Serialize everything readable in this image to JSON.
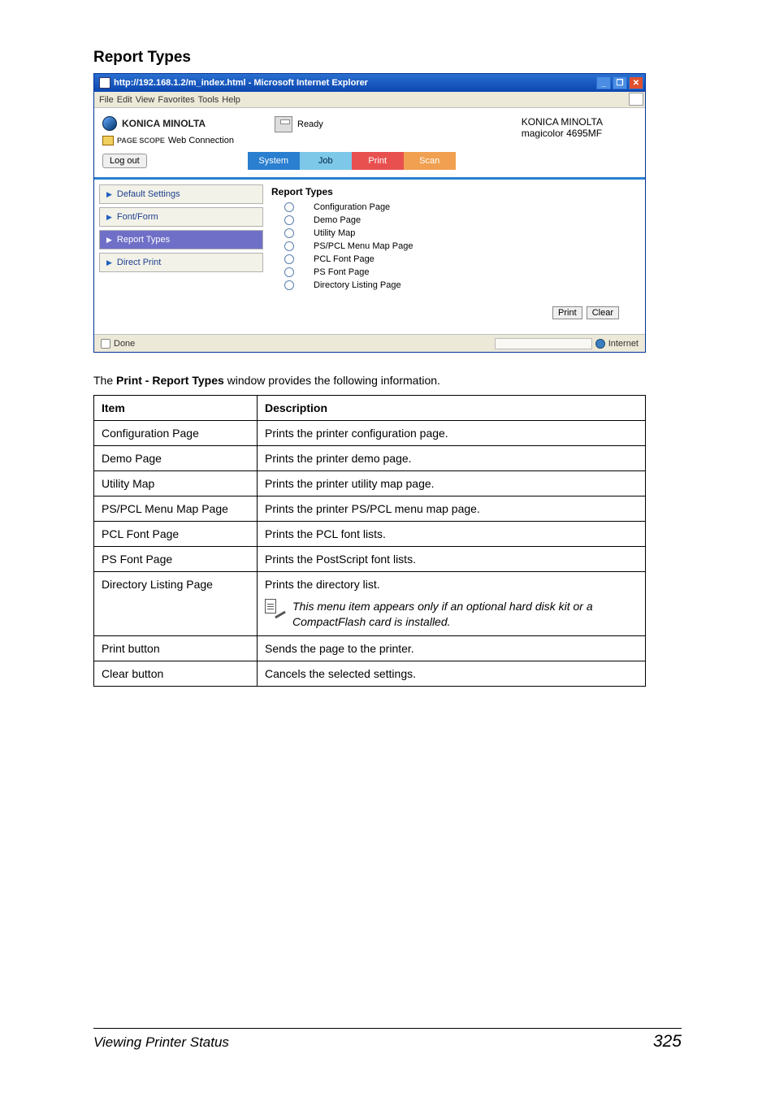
{
  "section_heading": "Report Types",
  "browser": {
    "title": "http://192.168.1.2/m_index.html - Microsoft Internet Explorer",
    "menu": [
      "File",
      "Edit",
      "View",
      "Favorites",
      "Tools",
      "Help"
    ],
    "brand": "KONICA MINOLTA",
    "pagescope_prefix": "PAGE SCOPE",
    "pagescope": "Web Connection",
    "status_text": "Ready",
    "model_brand": "KONICA MINOLTA",
    "model_name": "magicolor 4695MF",
    "logout": "Log out",
    "tabs": {
      "system": "System",
      "job": "Job",
      "print": "Print",
      "scan": "Scan"
    },
    "sidebar": {
      "items": [
        {
          "label": "Default Settings"
        },
        {
          "label": "Font/Form"
        },
        {
          "label": "Report Types"
        },
        {
          "label": "Direct Print"
        }
      ]
    },
    "panel_title": "Report Types",
    "options": [
      "Configuration Page",
      "Demo Page",
      "Utility Map",
      "PS/PCL Menu Map Page",
      "PCL Font Page",
      "PS Font Page",
      "Directory Listing Page"
    ],
    "print_btn": "Print",
    "clear_btn": "Clear",
    "status_done": "Done",
    "status_zone": "Internet"
  },
  "intro_pre": "The ",
  "intro_bold": "Print - Report Types",
  "intro_post": " window provides the following information.",
  "table": {
    "head_item": "Item",
    "head_desc": "Description",
    "rows": [
      {
        "item": "Configuration Page",
        "desc": "Prints the printer configuration page."
      },
      {
        "item": "Demo Page",
        "desc": "Prints the printer demo page."
      },
      {
        "item": "Utility Map",
        "desc": "Prints the printer utility map page."
      },
      {
        "item": "PS/PCL Menu Map Page",
        "desc": "Prints the printer PS/PCL menu map page."
      },
      {
        "item": "PCL Font Page",
        "desc": "Prints the PCL font lists."
      },
      {
        "item": "PS Font Page",
        "desc": "Prints the PostScript font lists."
      },
      {
        "item": "Directory Listing Page",
        "desc": "Prints the directory list.",
        "note": "This menu item appears only if an optional hard disk kit or a CompactFlash card is installed."
      },
      {
        "item": "Print button",
        "desc": "Sends the page to the printer."
      },
      {
        "item": "Clear button",
        "desc": "Cancels the selected settings."
      }
    ]
  },
  "footer": {
    "left": "Viewing Printer Status",
    "right": "325"
  }
}
